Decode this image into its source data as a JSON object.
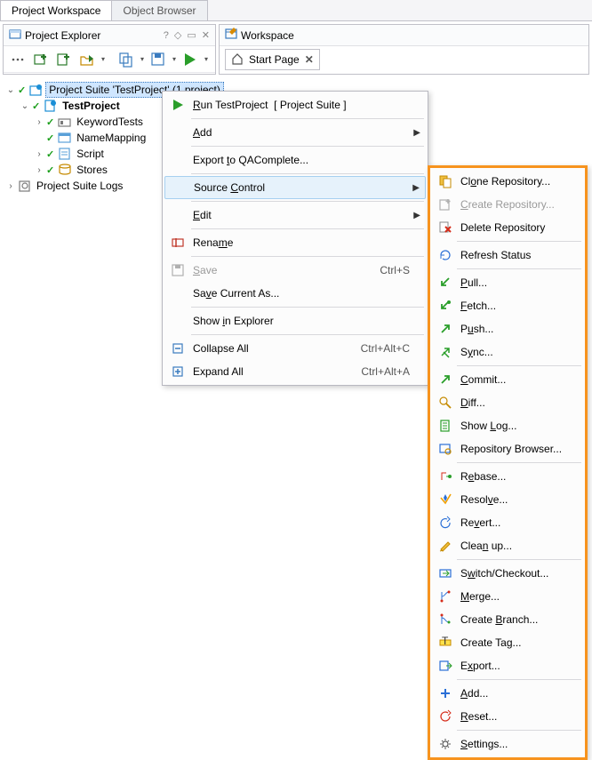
{
  "tabs": {
    "workspace": "Project Workspace",
    "browser": "Object Browser"
  },
  "panel": {
    "explorer": "Project Explorer",
    "workspace": "Workspace",
    "help": "?",
    "pin": "◇",
    "dock": "▭",
    "close": "✕"
  },
  "start": {
    "label": "Start Page",
    "close": "✕"
  },
  "tree": {
    "suite": "Project Suite 'TestProject' (1 project)",
    "project": "TestProject",
    "keyword": "KeywordTests",
    "namemap": "NameMapping",
    "script": "Script",
    "stores": "Stores",
    "logs": "Project Suite Logs"
  },
  "menu1": {
    "run": "Run TestProject  [ Project Suite ]",
    "add": "Add",
    "export_qa": "Export to QAComplete...",
    "source": "Source Control",
    "edit": "Edit",
    "rename": "Rename",
    "save": "Save",
    "save_key": "Ctrl+S",
    "saveas": "Save Current As...",
    "showexp": "Show in Explorer",
    "collapse": "Collapse All",
    "collapse_key": "Ctrl+Alt+C",
    "expand": "Expand All",
    "expand_key": "Ctrl+Alt+A"
  },
  "menu2": {
    "clone": "Clone Repository...",
    "create": "Create Repository...",
    "delete": "Delete Repository",
    "refresh": "Refresh Status",
    "pull": "Pull...",
    "fetch": "Fetch...",
    "push": "Push...",
    "sync": "Sync...",
    "commit": "Commit...",
    "diff": "Diff...",
    "showlog": "Show Log...",
    "repobrowser": "Repository Browser...",
    "rebase": "Rebase...",
    "resolve": "Resolve...",
    "revert": "Revert...",
    "cleanup": "Clean up...",
    "switch": "Switch/Checkout...",
    "merge": "Merge...",
    "branch": "Create Branch...",
    "tag": "Create Tag...",
    "export": "Export...",
    "addf": "Add...",
    "reset": "Reset...",
    "settings": "Settings..."
  }
}
